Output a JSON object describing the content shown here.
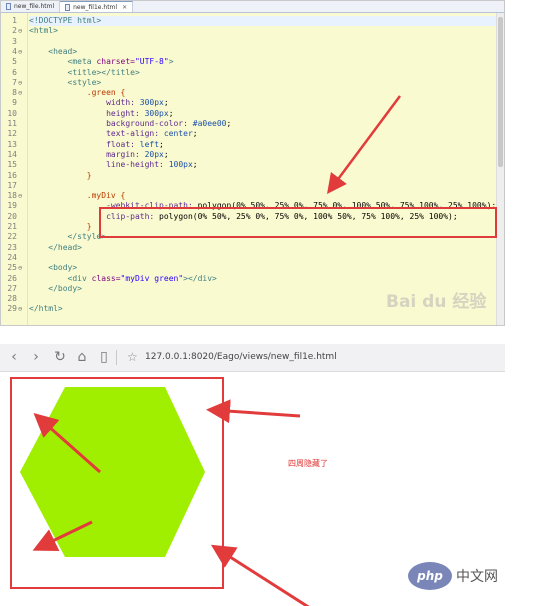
{
  "editor": {
    "tabs": [
      {
        "label": "new_file.html",
        "active": false
      },
      {
        "label": "new_fil1e.html",
        "active": true
      }
    ],
    "tab_close": "✕",
    "lines": [
      {
        "n": "1",
        "fold": "",
        "segments": [
          {
            "t": "<!DOCTYPE html>",
            "c": "t-tag"
          }
        ]
      },
      {
        "n": "2",
        "fold": "⊖",
        "segments": [
          {
            "t": "<html>",
            "c": "t-tag"
          }
        ]
      },
      {
        "n": "3",
        "fold": "",
        "segments": []
      },
      {
        "n": "4",
        "fold": "⊖",
        "segments": [
          {
            "t": "    <head>",
            "c": "t-tag"
          }
        ]
      },
      {
        "n": "5",
        "fold": "",
        "segments": [
          {
            "t": "        <meta ",
            "c": "t-tag"
          },
          {
            "t": "charset=",
            "c": "t-attr"
          },
          {
            "t": "\"UTF-8\"",
            "c": "t-str"
          },
          {
            "t": ">",
            "c": "t-tag"
          }
        ]
      },
      {
        "n": "6",
        "fold": "",
        "segments": [
          {
            "t": "        <title></title>",
            "c": "t-tag"
          }
        ]
      },
      {
        "n": "7",
        "fold": "⊖",
        "segments": [
          {
            "t": "        <style>",
            "c": "t-tag"
          }
        ]
      },
      {
        "n": "8",
        "fold": "⊖",
        "segments": [
          {
            "t": "            .green {",
            "c": "t-sel"
          }
        ]
      },
      {
        "n": "9",
        "fold": "",
        "segments": [
          {
            "t": "                width: ",
            "c": "t-prop"
          },
          {
            "t": "300px",
            "c": "t-val"
          },
          {
            "t": ";",
            "c": "t-plain"
          }
        ]
      },
      {
        "n": "10",
        "fold": "",
        "segments": [
          {
            "t": "                height: ",
            "c": "t-prop"
          },
          {
            "t": "300px",
            "c": "t-val"
          },
          {
            "t": ";",
            "c": "t-plain"
          }
        ]
      },
      {
        "n": "11",
        "fold": "",
        "segments": [
          {
            "t": "                background-color: ",
            "c": "t-prop"
          },
          {
            "t": "#a0ee00",
            "c": "t-val"
          },
          {
            "t": ";",
            "c": "t-plain"
          }
        ]
      },
      {
        "n": "12",
        "fold": "",
        "segments": [
          {
            "t": "                text-align: ",
            "c": "t-prop"
          },
          {
            "t": "center",
            "c": "t-val"
          },
          {
            "t": ";",
            "c": "t-plain"
          }
        ]
      },
      {
        "n": "13",
        "fold": "",
        "segments": [
          {
            "t": "                float: ",
            "c": "t-prop"
          },
          {
            "t": "left",
            "c": "t-val"
          },
          {
            "t": ";",
            "c": "t-plain"
          }
        ]
      },
      {
        "n": "14",
        "fold": "",
        "segments": [
          {
            "t": "                margin: ",
            "c": "t-prop"
          },
          {
            "t": "20px",
            "c": "t-val"
          },
          {
            "t": ";",
            "c": "t-plain"
          }
        ]
      },
      {
        "n": "15",
        "fold": "",
        "segments": [
          {
            "t": "                line-height: ",
            "c": "t-prop"
          },
          {
            "t": "100px",
            "c": "t-val"
          },
          {
            "t": ";",
            "c": "t-plain"
          }
        ]
      },
      {
        "n": "16",
        "fold": "",
        "segments": [
          {
            "t": "            }",
            "c": "t-sel"
          }
        ]
      },
      {
        "n": "17",
        "fold": "",
        "segments": []
      },
      {
        "n": "18",
        "fold": "⊖",
        "segments": [
          {
            "t": "            .myDiv {",
            "c": "t-sel"
          }
        ]
      },
      {
        "n": "19",
        "fold": "",
        "segments": [
          {
            "t": "                -webkit-clip-path: ",
            "c": "t-prop"
          },
          {
            "t": "polygon(0% 50%, 25% 0%, 75% 0%, 100% 50%, 75% 100%, 25% 100%)",
            "c": "t-plain"
          },
          {
            "t": ";",
            "c": "t-plain"
          }
        ]
      },
      {
        "n": "20",
        "fold": "",
        "segments": [
          {
            "t": "                clip-path: ",
            "c": "t-prop"
          },
          {
            "t": "polygon(0% 50%, 25% 0%, 75% 0%, 100% 50%, 75% 100%, 25% 100%)",
            "c": "t-plain"
          },
          {
            "t": ";",
            "c": "t-plain"
          }
        ]
      },
      {
        "n": "21",
        "fold": "",
        "segments": [
          {
            "t": "            }",
            "c": "t-sel"
          }
        ]
      },
      {
        "n": "22",
        "fold": "",
        "segments": [
          {
            "t": "        </style>",
            "c": "t-tag"
          }
        ]
      },
      {
        "n": "23",
        "fold": "",
        "segments": [
          {
            "t": "    </head>",
            "c": "t-tag"
          }
        ]
      },
      {
        "n": "24",
        "fold": "",
        "segments": []
      },
      {
        "n": "25",
        "fold": "⊖",
        "segments": [
          {
            "t": "    <body>",
            "c": "t-tag"
          }
        ]
      },
      {
        "n": "26",
        "fold": "",
        "segments": [
          {
            "t": "        <div ",
            "c": "t-tag"
          },
          {
            "t": "class=",
            "c": "t-attr"
          },
          {
            "t": "\"myDiv green\"",
            "c": "t-str"
          },
          {
            "t": "></div>",
            "c": "t-tag"
          }
        ]
      },
      {
        "n": "27",
        "fold": "",
        "segments": [
          {
            "t": "    </body>",
            "c": "t-tag"
          }
        ]
      },
      {
        "n": "28",
        "fold": "",
        "segments": []
      },
      {
        "n": "29",
        "fold": "⊖",
        "segments": [
          {
            "t": "</html>",
            "c": "t-tag"
          }
        ]
      }
    ],
    "watermark": "Bai du 经验"
  },
  "browser": {
    "nav": {
      "back": "‹",
      "forward": "›",
      "reload": "↻",
      "home": "⌂",
      "reading": "▯"
    },
    "star": "☆",
    "url": "127.0.0.1:8020/Eago/views/new_fil1e.html",
    "note": "四周隐藏了",
    "shape_color": "#a0ee00",
    "highlight_color": "#e23b3b"
  },
  "footer": {
    "logo": "php",
    "site": "中文网"
  }
}
